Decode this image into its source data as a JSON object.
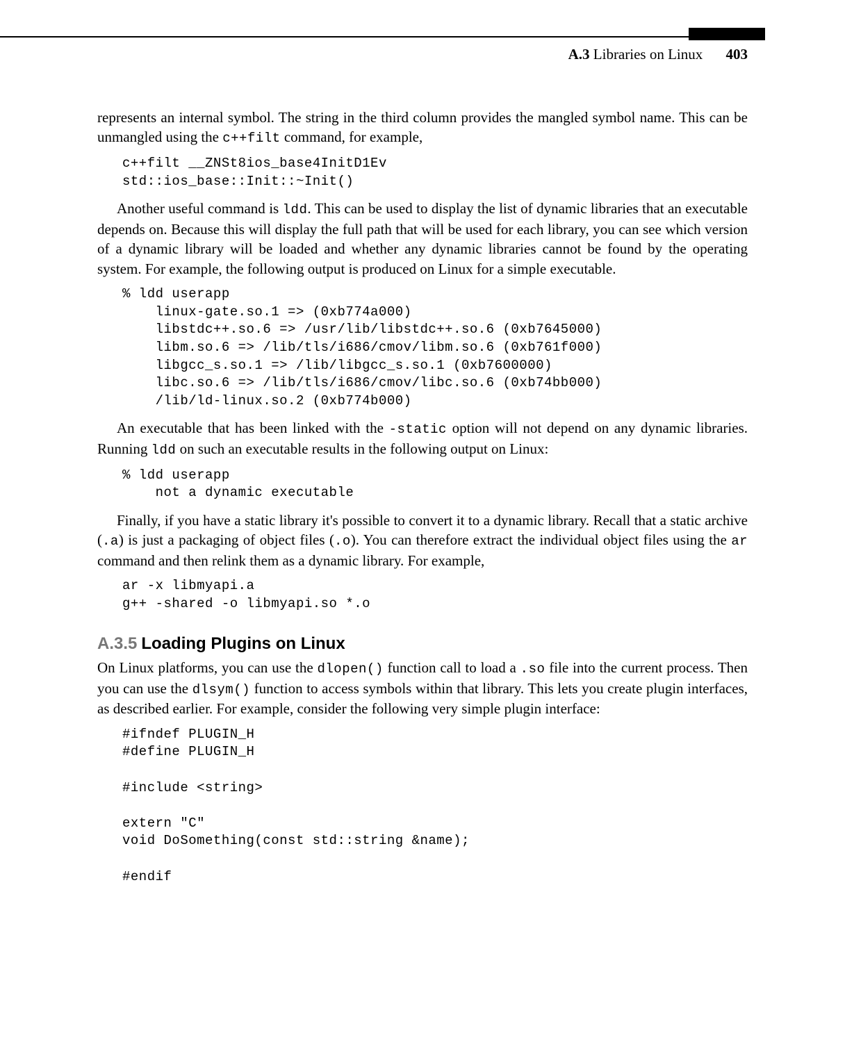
{
  "header": {
    "section_number": "A.3",
    "section_title": "Libraries on Linux",
    "page_number": "403"
  },
  "para1_a": "represents an internal symbol. The string in the third column provides the mangled symbol name. This can be unmangled using the ",
  "para1_code": "c++filt",
  "para1_b": " command, for example,",
  "code1": "c++filt __ZNSt8ios_base4InitD1Ev\nstd::ios_base::Init::~Init()",
  "para2_a": "Another useful command is ",
  "para2_code": "ldd",
  "para2_b": ". This can be used to display the list of dynamic libraries that an executable depends on. Because this will display the full path that will be used for each library, you can see which version of a dynamic library will be loaded and whether any dynamic libraries cannot be found by the operating system. For example, the following output is produced on Linux for a simple executable.",
  "code2": "% ldd userapp\n    linux-gate.so.1 => (0xb774a000)\n    libstdc++.so.6 => /usr/lib/libstdc++.so.6 (0xb7645000)\n    libm.so.6 => /lib/tls/i686/cmov/libm.so.6 (0xb761f000)\n    libgcc_s.so.1 => /lib/libgcc_s.so.1 (0xb7600000)\n    libc.so.6 => /lib/tls/i686/cmov/libc.so.6 (0xb74bb000)\n    /lib/ld-linux.so.2 (0xb774b000)",
  "para3_a": "An executable that has been linked with the ",
  "para3_code1": "-static",
  "para3_b": " option will not depend on any dynamic libraries. Running ",
  "para3_code2": "ldd",
  "para3_c": " on such an executable results in the following output on Linux:",
  "code3": "% ldd userapp\n    not a dynamic executable",
  "para4_a": "Finally, if you have a static library it's possible to convert it to a dynamic library. Recall that a static archive (",
  "para4_code1": ".a",
  "para4_b": ") is just a packaging of object files (",
  "para4_code2": ".o",
  "para4_c": "). You can therefore extract the individual object files using the ",
  "para4_code3": "ar",
  "para4_d": " command and then relink them as a dynamic library. For example,",
  "code4": "ar -x libmyapi.a\ng++ -shared -o libmyapi.so *.o",
  "section": {
    "number": "A.3.5",
    "title": "Loading Plugins on Linux"
  },
  "para5_a": "On Linux platforms, you can use the ",
  "para5_code1": "dlopen()",
  "para5_b": " function call to load a ",
  "para5_code2": ".so",
  "para5_c": " file into the current process. Then you can use the ",
  "para5_code3": "dlsym()",
  "para5_d": " function to access symbols within that library. This lets you create plugin interfaces, as described earlier. For example, consider the following very simple plugin interface:",
  "code5": "#ifndef PLUGIN_H\n#define PLUGIN_H\n\n#include <string>\n\nextern \"C\"\nvoid DoSomething(const std::string &name);\n\n#endif"
}
